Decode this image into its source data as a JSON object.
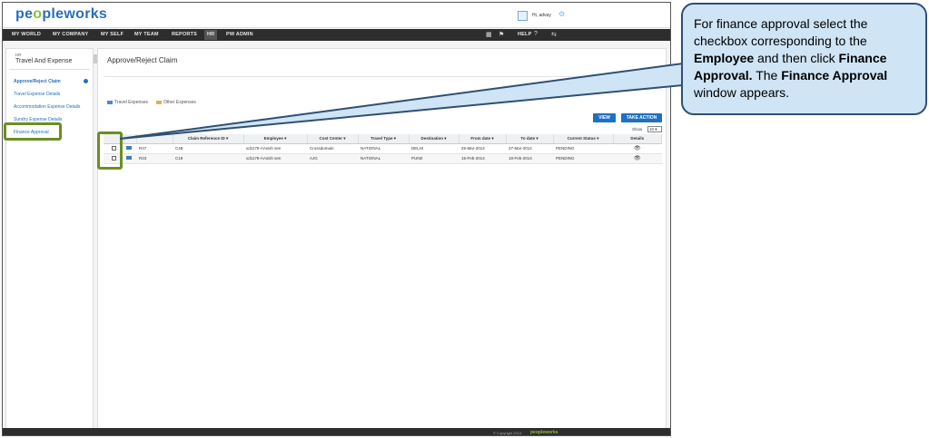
{
  "app": {
    "logo_main": "pe",
    "logo_o": "o",
    "logo_rest": "pleworks",
    "user_greeting": "Hi, advay"
  },
  "nav": {
    "items": [
      "MY WORLD",
      "MY COMPANY",
      "MY SELF",
      "MY TEAM",
      "REPORTS",
      "HR",
      "PW ADMIN"
    ],
    "active": "HR",
    "help": "HELP"
  },
  "sidebar": {
    "module": "HR",
    "title": "Travel And Expense",
    "items": [
      "Approve/Reject Claim",
      "Travel Expense Details",
      "Accommodation Expense Details",
      "Sundry Expense Details",
      "Finance Approval"
    ]
  },
  "main": {
    "title": "Approve/Reject Claim",
    "tabs": [
      "Travel Expenses",
      "Other Expenses"
    ],
    "buttons": {
      "view": "VIEW",
      "take_action": "TAKE ACTION"
    },
    "show_label": "Show",
    "show_value": "10",
    "table": {
      "headers": [
        "",
        "",
        "",
        "Claim Reference ID",
        "Employee",
        "Cost Center",
        "Travel Type",
        "Destination",
        "From date",
        "To date",
        "Current Status",
        "Details"
      ],
      "rows": [
        {
          "id": "R47",
          "claim_ref": "C49",
          "employee": "xd1178-AAsish sen",
          "cost_center": "Crossdomain",
          "travel_type": "NATIONAL",
          "destination": "DELHI",
          "from": "25-Mar-2014",
          "to": "27-Mar-2014",
          "status": "PENDING"
        },
        {
          "id": "R23",
          "claim_ref": "C19",
          "employee": "xd1178-AAsish sen",
          "cost_center": "AJG",
          "travel_type": "NATIONAL",
          "destination": "PUNE",
          "from": "15-Feb-2014",
          "to": "18-Feb-2014",
          "status": "PENDING"
        }
      ]
    }
  },
  "footer": {
    "text": "© Copyright 2014",
    "logo": "peopleworks"
  },
  "callout": {
    "t1": "For finance approval select the checkbox corresponding to the ",
    "b1": "Employee",
    "t2": " and then click ",
    "b2": "Finance Approval.",
    "t3": "  The ",
    "b3": "Finance Approval",
    "t4": " window appears."
  },
  "colors": {
    "accent_blue": "#1f6fc2",
    "brand_green": "#8cbf3f",
    "highlight_green": "#6b8e23",
    "callout_fill": "#cfe4f5",
    "callout_border": "#2f4f73",
    "nav_dark": "#2d2d2d"
  },
  "icons": {
    "user": "user-icon",
    "settings": "gear-icon",
    "help": "help-icon",
    "ticket": "ticket-icon",
    "details": "eye-icon"
  }
}
